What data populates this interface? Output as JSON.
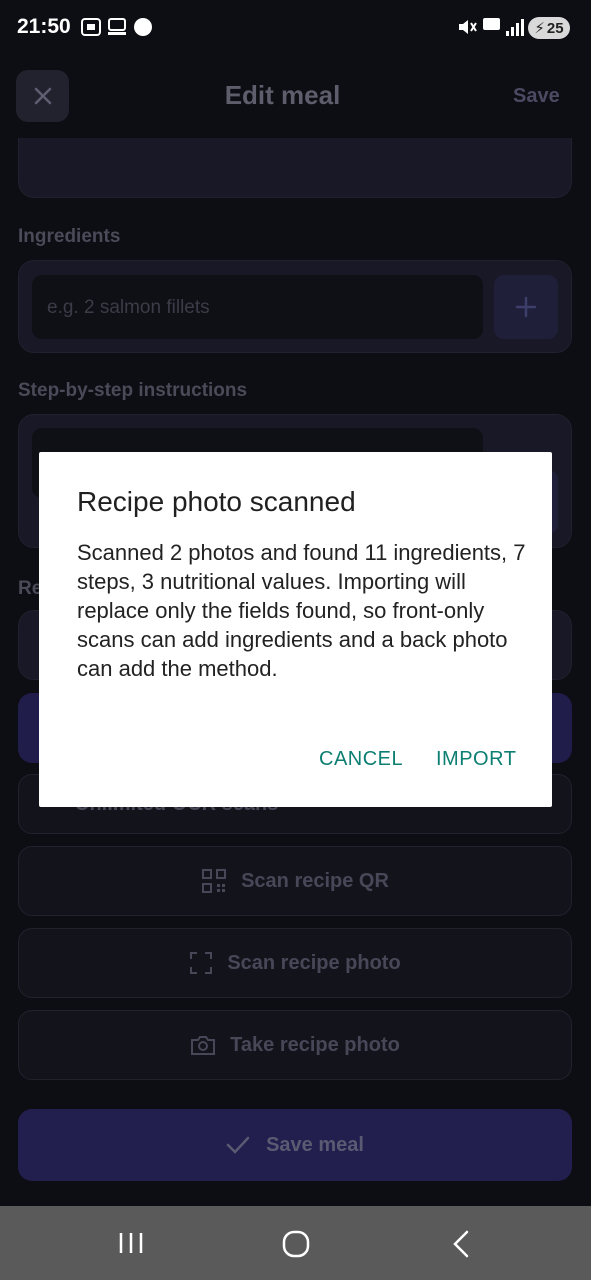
{
  "status_bar": {
    "time": "21:50",
    "battery": "25"
  },
  "header": {
    "title": "Edit meal",
    "save_label": "Save"
  },
  "form": {
    "ingredients_label": "Ingredients",
    "ingredient_placeholder": "e.g. 2 salmon fillets",
    "instructions_label": "Step-by-step instructions",
    "partial_label": "Re",
    "unlimited_text": "Unlimited OCR scans",
    "scan_qr_label": "Scan recipe QR",
    "scan_photo_label": "Scan recipe photo",
    "take_photo_label": "Take recipe photo",
    "save_meal_label": "Save meal"
  },
  "dialog": {
    "title": "Recipe photo scanned",
    "message": "Scanned 2 photos and found 11 ingredients, 7 steps, 3 nutritional values. Importing will replace only the fields found, so front-only scans can add ingredients and a back photo can add the method.",
    "cancel_label": "CANCEL",
    "import_label": "IMPORT"
  },
  "colors": {
    "accent": "#0c7f72",
    "background": "#0d0d14",
    "overlay_purple": "#201d4a"
  }
}
